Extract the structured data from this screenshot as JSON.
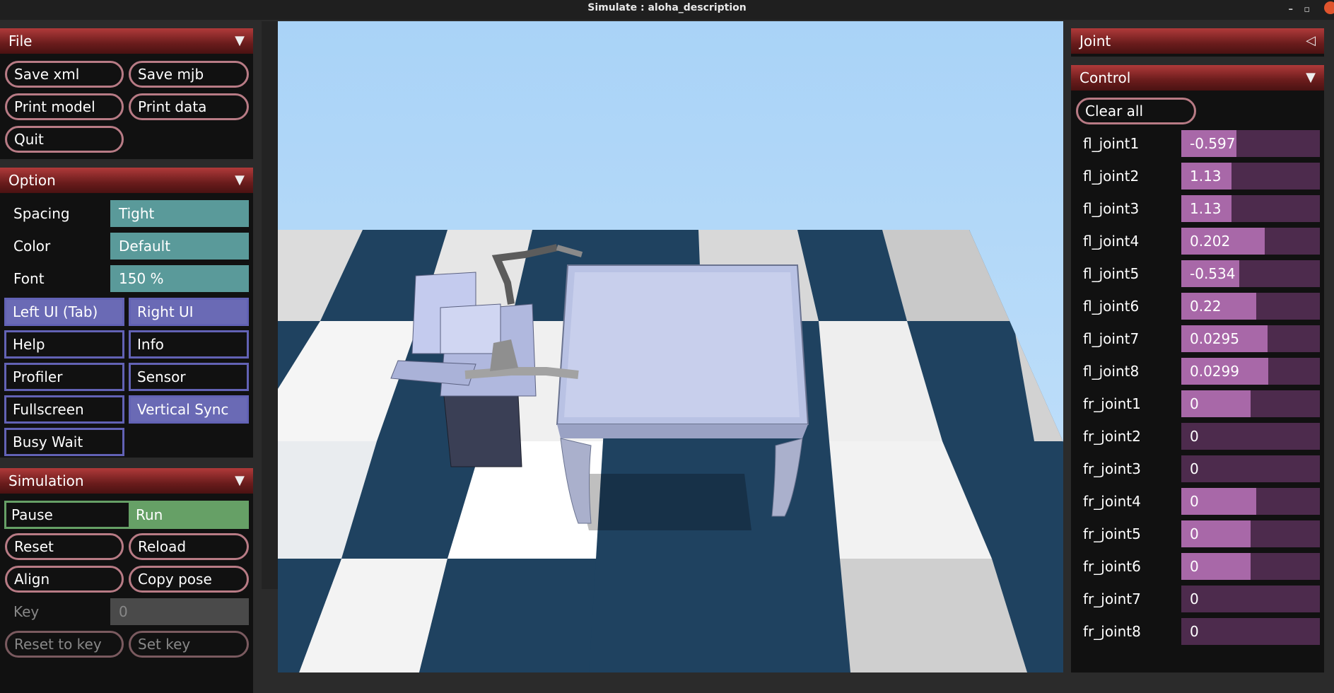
{
  "window": {
    "title": "Simulate : aloha_description"
  },
  "file_section": {
    "title": "File",
    "buttons": [
      "Save xml",
      "Save mjb",
      "Print model",
      "Print data",
      "Quit"
    ]
  },
  "option_section": {
    "title": "Option",
    "spacing": {
      "label": "Spacing",
      "value": "Tight"
    },
    "color": {
      "label": "Color",
      "value": "Default"
    },
    "font": {
      "label": "Font",
      "value": "150 %"
    },
    "toggles": [
      {
        "label": "Left UI (Tab)",
        "on": true
      },
      {
        "label": "Right UI",
        "on": true
      },
      {
        "label": "Help",
        "on": false
      },
      {
        "label": "Info",
        "on": false
      },
      {
        "label": "Profiler",
        "on": false
      },
      {
        "label": "Sensor",
        "on": false
      },
      {
        "label": "Fullscreen",
        "on": false
      },
      {
        "label": "Vertical Sync",
        "on": true
      },
      {
        "label": "Busy Wait",
        "on": false
      }
    ]
  },
  "simulation_section": {
    "title": "Simulation",
    "pause_label": "Pause",
    "run_label": "Run",
    "buttons": [
      "Reset",
      "Reload",
      "Align",
      "Copy pose"
    ],
    "key": {
      "label": "Key",
      "value": "0"
    },
    "key_buttons": [
      "Reset to key",
      "Set key"
    ]
  },
  "joint_section": {
    "title": "Joint"
  },
  "control_section": {
    "title": "Control",
    "clear_label": "Clear all",
    "joints": [
      {
        "name": "fl_joint1",
        "value": "-0.597",
        "fill": 0.4
      },
      {
        "name": "fl_joint2",
        "value": "1.13",
        "fill": 0.36
      },
      {
        "name": "fl_joint3",
        "value": "1.13",
        "fill": 0.36
      },
      {
        "name": "fl_joint4",
        "value": "0.202",
        "fill": 0.6
      },
      {
        "name": "fl_joint5",
        "value": "-0.534",
        "fill": 0.42
      },
      {
        "name": "fl_joint6",
        "value": "0.22",
        "fill": 0.54
      },
      {
        "name": "fl_joint7",
        "value": "0.0295",
        "fill": 0.62
      },
      {
        "name": "fl_joint8",
        "value": "0.0299",
        "fill": 0.63
      },
      {
        "name": "fr_joint1",
        "value": "0",
        "fill": 0.5
      },
      {
        "name": "fr_joint2",
        "value": "0",
        "fill": 0.0
      },
      {
        "name": "fr_joint3",
        "value": "0",
        "fill": 0.0
      },
      {
        "name": "fr_joint4",
        "value": "0",
        "fill": 0.54
      },
      {
        "name": "fr_joint5",
        "value": "0",
        "fill": 0.5
      },
      {
        "name": "fr_joint6",
        "value": "0",
        "fill": 0.5
      },
      {
        "name": "fr_joint7",
        "value": "0",
        "fill": 0.0
      },
      {
        "name": "fr_joint8",
        "value": "0",
        "fill": 0.0
      }
    ]
  },
  "colors": {
    "header_red": "#8b2525",
    "toggle_on": "#6a6ab5",
    "select_teal": "#5a9a9a",
    "run_green": "#66a066",
    "slider_fill": "#a868a8"
  }
}
